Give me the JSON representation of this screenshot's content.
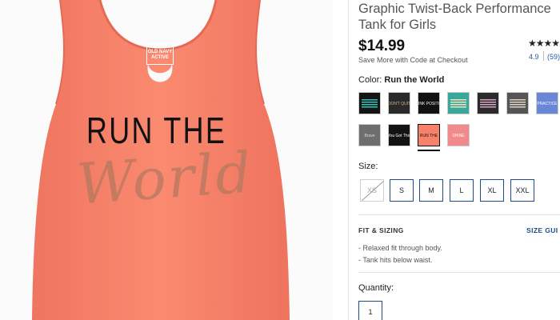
{
  "product_image": {
    "shirt_color": "#f7826a",
    "print_line1": "RUN THE",
    "print_line2": "World",
    "label_text": "OLD NAVY ACTIVE"
  },
  "product": {
    "title_line1": "Graphic Twist-Back Performance",
    "title_line2": "Tank for Girls",
    "price": "$14.99",
    "price_note": "Save More with Code at Checkout"
  },
  "rating": {
    "stars": "★★★★★",
    "value": "4.9",
    "count": "(59)"
  },
  "color": {
    "label": "Color:",
    "selected": "Run the World",
    "swatches": [
      {
        "name": "swatch-black-stripes",
        "bg": "#151515",
        "accent": "#2ec4b6",
        "text": ""
      },
      {
        "name": "swatch-dont-quit",
        "bg": "#2a2a2a",
        "accent": "#d8b48f",
        "text": "DON'T QUIT"
      },
      {
        "name": "swatch-think-positive",
        "bg": "#111111",
        "accent": "#f3f3f3",
        "text": "THINK POSITIVE"
      },
      {
        "name": "swatch-teal-pattern",
        "bg": "#3aa79b",
        "accent": "#f1e2b8",
        "text": ""
      },
      {
        "name": "swatch-dots",
        "bg": "#2b2b2b",
        "accent": "#d6a3c4",
        "text": ""
      },
      {
        "name": "swatch-gray-script",
        "bg": "#555555",
        "accent": "#e0d2c2",
        "text": ""
      },
      {
        "name": "swatch-practice",
        "bg": "#6a86d6",
        "accent": "#ffffff",
        "text": "PRACTICE"
      },
      {
        "name": "swatch-gray-brave",
        "bg": "#6e6e6e",
        "accent": "#dcdcdc",
        "text": "Brave"
      },
      {
        "name": "swatch-you-got-this",
        "bg": "#131313",
        "accent": "#ffffff",
        "text": "You Got This"
      },
      {
        "name": "swatch-run-the-world",
        "bg": "#f7826a",
        "accent": "#111111",
        "text": "RUN THE"
      },
      {
        "name": "swatch-pink-shine",
        "bg": "#f18a8a",
        "accent": "#ffffff",
        "text": "SHINE"
      }
    ]
  },
  "size": {
    "label": "Size:",
    "options": [
      "XS",
      "S",
      "M",
      "L",
      "XL",
      "XXL"
    ],
    "unavailable": "XS"
  },
  "fit": {
    "heading": "FIT & SIZING",
    "size_guide_link": "SIZE GUI",
    "items": [
      "- Relaxed fit through body.",
      "- Tank hits below waist."
    ]
  },
  "quantity": {
    "label": "Quantity:",
    "value": "1"
  }
}
